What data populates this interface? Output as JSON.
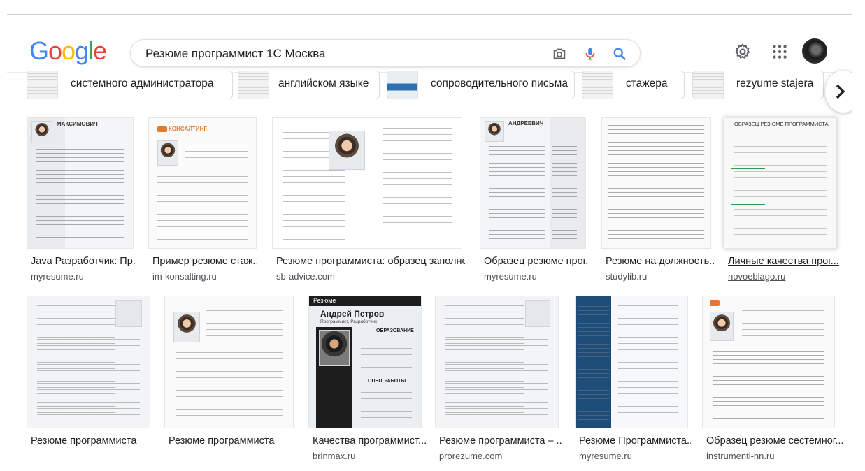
{
  "search": {
    "query": "Резюме программист 1С Москва"
  },
  "logo": {
    "letters": [
      "G",
      "o",
      "o",
      "g",
      "l",
      "e"
    ],
    "colors": [
      "#4285F4",
      "#EA4335",
      "#FBBC05",
      "#4285F4",
      "#34A853",
      "#EA4335"
    ]
  },
  "chips": [
    {
      "label": "системного администратора"
    },
    {
      "label": "английском языке"
    },
    {
      "label": "сопроводительного письма"
    },
    {
      "label": "стажера"
    },
    {
      "label": "rezyume stajera"
    }
  ],
  "results_row1": [
    {
      "title": "Java Разработчик: Пр...",
      "source": "myresume.ru"
    },
    {
      "title": "Пример резюме стаж...",
      "source": "im-konsalting.ru"
    },
    {
      "title": "Резюме программиста: образец заполне...",
      "source": "sb-advice.com"
    },
    {
      "title": "Образец резюме прог...",
      "source": "myresume.ru"
    },
    {
      "title": "Резюме на должность...",
      "source": "studylib.ru"
    },
    {
      "title": "Личные качества прог...",
      "source": "novoeblago.ru"
    }
  ],
  "results_row2": [
    {
      "title": "Резюме программиста",
      "source": ""
    },
    {
      "title": "Резюме программиста",
      "source": ""
    },
    {
      "title": "Качества программист...",
      "source": "brinmax.ru"
    },
    {
      "title": "Резюме программиста – ...",
      "source": "prorezume.com"
    },
    {
      "title": "Резюме Программиста...",
      "source": "myresume.ru"
    },
    {
      "title": "Образец резюме сестемног...",
      "source": "instrumenti-nn.ru"
    }
  ],
  "thumb_text": {
    "maximovich": "МАКСИМОВИЧ",
    "andreevich": "АНДРЕЕВИЧ",
    "konsalting": "КОНСАЛТИНГ",
    "obrazec": "ОБРАЗЕЦ РЕЗЮМЕ ПРОГРАММИСТА",
    "resume_word": "Резюме",
    "petrov_name": "Андрей Петров",
    "petrov_role": "Программист, Разработчик",
    "education": "ОБРАЗОВАНИЕ",
    "experience": "ОПЫТ РАБОТЫ"
  }
}
